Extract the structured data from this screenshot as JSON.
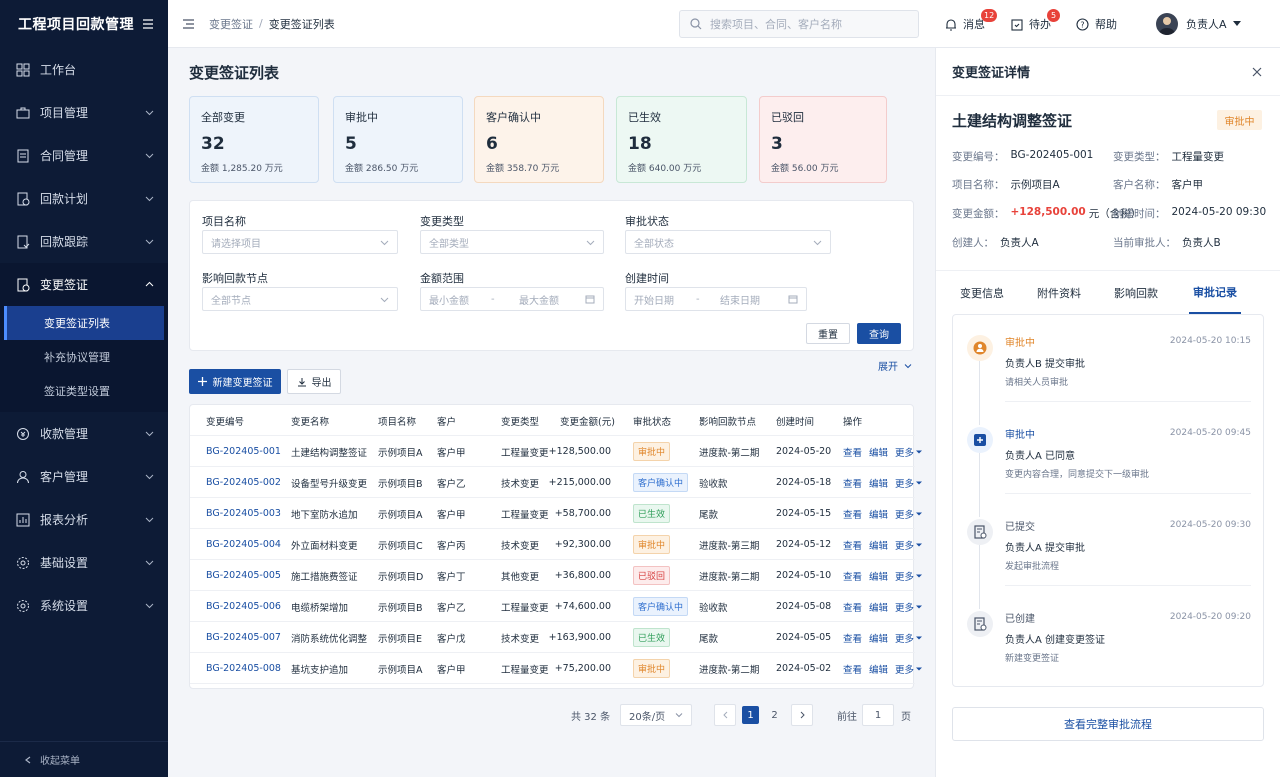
{
  "app": {
    "title": "工程项目回款管理"
  },
  "sidebar": {
    "items": [
      {
        "label": "工作台",
        "icon": "dashboard-icon"
      },
      {
        "label": "项目管理",
        "icon": "briefcase-icon"
      },
      {
        "label": "合同管理",
        "icon": "document-icon"
      },
      {
        "label": "回款计划",
        "icon": "plan-icon"
      },
      {
        "label": "回款跟踪",
        "icon": "track-icon"
      },
      {
        "label": "变更签证",
        "icon": "change-icon"
      },
      {
        "label": "收款管理",
        "icon": "payment-icon"
      },
      {
        "label": "客户管理",
        "icon": "user-icon"
      },
      {
        "label": "报表分析",
        "icon": "chart-icon"
      },
      {
        "label": "基础设置",
        "icon": "gear-icon"
      },
      {
        "label": "系统设置",
        "icon": "settings-icon"
      }
    ],
    "sub_items": [
      "变更签证列表",
      "补充协议管理",
      "签证类型设置"
    ],
    "collapse_label": "收起菜单"
  },
  "topbar": {
    "breadcrumb": [
      "变更签证",
      "变更签证列表"
    ],
    "search_placeholder": "搜索项目、合同、客户名称",
    "messages_label": "消息",
    "messages_count": "12",
    "todo_label": "待办",
    "todo_count": "5",
    "help_label": "帮助",
    "user_name": "负责人A"
  },
  "main": {
    "title": "变更签证列表",
    "stats": [
      {
        "title": "全部变更",
        "count": "32",
        "amount": "金额  1,285.20 万元",
        "bg": "#eef4fb",
        "border": "#cfdff2"
      },
      {
        "title": "审批中",
        "count": "5",
        "amount": "金额  286.50 万元",
        "bg": "#eef4fb",
        "border": "#cfdff2"
      },
      {
        "title": "客户确认中",
        "count": "6",
        "amount": "金额  358.70 万元",
        "bg": "#fdf3ea",
        "border": "#f4d9bf"
      },
      {
        "title": "已生效",
        "count": "18",
        "amount": "金额  640.00 万元",
        "bg": "#edf8f3",
        "border": "#c8e8d6"
      },
      {
        "title": "已驳回",
        "count": "3",
        "amount": "金额  56.00 万元",
        "bg": "#fdeeee",
        "border": "#f3cccc"
      }
    ],
    "filters": {
      "project_label": "项目名称",
      "project_value": "请选择项目",
      "type_label": "变更类型",
      "type_value": "全部类型",
      "status_label": "审批状态",
      "status_value": "全部状态",
      "node_label": "影响回款节点",
      "node_value": "全部节点",
      "amount_label": "金额范围",
      "amount_min": "最小金额",
      "amount_sep": "-",
      "amount_max": "最大金额",
      "date_label": "创建时间",
      "date_start": "开始日期",
      "date_sep": "-",
      "date_end": "结束日期",
      "reset_label": "重置",
      "query_label": "查询",
      "expand_label": "展开"
    },
    "new_button": "新建变更签证",
    "export_button": "导出",
    "table": {
      "columns": [
        "变更编号",
        "变更名称",
        "项目名称",
        "客户",
        "变更类型",
        "变更金额(元)",
        "审批状态",
        "影响回款节点",
        "创建时间",
        "操作"
      ],
      "ops": [
        "查看",
        "编辑",
        "更多"
      ],
      "rows": [
        {
          "id": "BG-202405-001",
          "name": "土建结构调整签证",
          "project": "示例项目A",
          "client": "客户甲",
          "type": "工程量变更",
          "amount": "+128,500.00",
          "status": "审批中",
          "status_kind": "pending",
          "node": "进度款-第二期",
          "date": "2024-05-20"
        },
        {
          "id": "BG-202405-002",
          "name": "设备型号升级变更",
          "project": "示例项目B",
          "client": "客户乙",
          "type": "技术变更",
          "amount": "+215,000.00",
          "status": "客户确认中",
          "status_kind": "confirm",
          "node": "验收款",
          "date": "2024-05-18"
        },
        {
          "id": "BG-202405-003",
          "name": "地下室防水追加",
          "project": "示例项目A",
          "client": "客户甲",
          "type": "工程量变更",
          "amount": "+58,700.00",
          "status": "已生效",
          "status_kind": "done",
          "node": "尾款",
          "date": "2024-05-15"
        },
        {
          "id": "BG-202405-004",
          "name": "外立面材料变更",
          "project": "示例项目C",
          "client": "客户丙",
          "type": "技术变更",
          "amount": "+92,300.00",
          "status": "审批中",
          "status_kind": "pending",
          "node": "进度款-第三期",
          "date": "2024-05-12"
        },
        {
          "id": "BG-202405-005",
          "name": "施工措施费签证",
          "project": "示例项目D",
          "client": "客户丁",
          "type": "其他变更",
          "amount": "+36,800.00",
          "status": "已驳回",
          "status_kind": "rejected",
          "node": "进度款-第二期",
          "date": "2024-05-10"
        },
        {
          "id": "BG-202405-006",
          "name": "电缆桥架增加",
          "project": "示例项目B",
          "client": "客户乙",
          "type": "工程量变更",
          "amount": "+74,600.00",
          "status": "客户确认中",
          "status_kind": "confirm",
          "node": "验收款",
          "date": "2024-05-08"
        },
        {
          "id": "BG-202405-007",
          "name": "消防系统优化调整",
          "project": "示例项目E",
          "client": "客户戊",
          "type": "技术变更",
          "amount": "+163,900.00",
          "status": "已生效",
          "status_kind": "done",
          "node": "尾款",
          "date": "2024-05-05"
        },
        {
          "id": "BG-202405-008",
          "name": "基坑支护追加",
          "project": "示例项目A",
          "client": "客户甲",
          "type": "工程量变更",
          "amount": "+75,200.00",
          "status": "审批中",
          "status_kind": "pending",
          "node": "进度款-第二期",
          "date": "2024-05-02"
        }
      ]
    },
    "pagination": {
      "total": "共 32 条",
      "page_size": "20条/页",
      "pages": [
        "1",
        "2"
      ],
      "goto_label": "前往",
      "goto_value": "1",
      "page_unit": "页"
    }
  },
  "panel": {
    "title": "变更签证详情",
    "name": "土建结构调整签证",
    "status": "审批中",
    "fields": {
      "code_k": "变更编号：",
      "code_v": "BG-202405-001",
      "type_k": "变更类型：",
      "type_v": "工程量变更",
      "project_k": "项目名称：",
      "project_v": "示例项目A",
      "client_k": "客户名称：",
      "client_v": "客户甲",
      "amount_k": "变更金额：",
      "amount_v": "+128,500.00",
      "amount_unit": "元（含税）",
      "created_k": "创建时间：",
      "created_v": "2024-05-20 09:30",
      "creator_k": "创建人：",
      "creator_v": "负责人A",
      "approver_k": "当前审批人：",
      "approver_v": "负责人B"
    },
    "tabs": [
      "变更信息",
      "附件资料",
      "影响回款",
      "审批记录"
    ],
    "timeline": [
      {
        "status": "审批中",
        "color": "#e0862b",
        "time": "2024-05-20 10:15",
        "action": "负责人B 提交审批",
        "note": "请相关人员审批"
      },
      {
        "status": "审批中",
        "color": "#1a4fa3",
        "time": "2024-05-20 09:45",
        "action": "负责人A 已同意",
        "note": "变更内容合理，同意提交下一级审批"
      },
      {
        "status": "已提交",
        "color": "#4a5568",
        "time": "2024-05-20 09:30",
        "action": "负责人A 提交审批",
        "note": "发起审批流程"
      },
      {
        "status": "已创建",
        "color": "#4a5568",
        "time": "2024-05-20 09:20",
        "action": "负责人A 创建变更签证",
        "note": "新建变更签证"
      }
    ],
    "view_full_label": "查看完整审批流程"
  }
}
